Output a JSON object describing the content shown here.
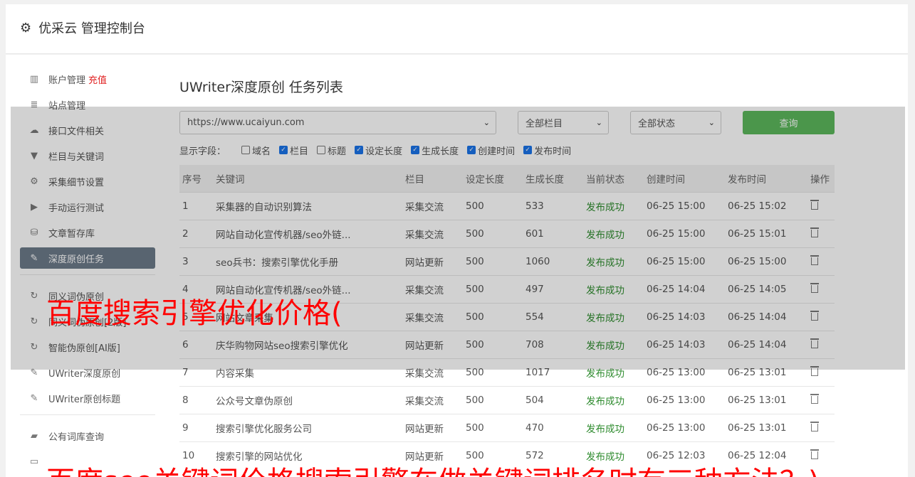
{
  "header": {
    "icon": "gear-icon",
    "title": "优采云 管理控制台"
  },
  "sidebar": {
    "group1": [
      {
        "icon": "bar-chart-icon",
        "glyph": "▥",
        "label": "账户管理",
        "badge": "充值"
      },
      {
        "icon": "server-icon",
        "glyph": "≣",
        "label": "站点管理"
      },
      {
        "icon": "cloud-upload-icon",
        "glyph": "☁",
        "label": "接口文件相关"
      },
      {
        "icon": "filter-icon",
        "glyph": "▼",
        "label": "栏目与关键词"
      },
      {
        "icon": "gears-icon",
        "glyph": "⚙",
        "label": "采集细节设置"
      },
      {
        "icon": "play-icon",
        "glyph": "▶",
        "label": "手动运行测试"
      },
      {
        "icon": "database-icon",
        "glyph": "⛁",
        "label": "文章暂存库"
      },
      {
        "icon": "edit-icon",
        "glyph": "✎",
        "label": "深度原创任务",
        "active": true
      }
    ],
    "group2": [
      {
        "icon": "refresh-icon",
        "glyph": "↻",
        "label": "同义词伪原创"
      },
      {
        "icon": "refresh-icon",
        "glyph": "↻",
        "label": "同义词伪原创[2版]"
      },
      {
        "icon": "refresh-icon",
        "glyph": "↻",
        "label": "智能伪原创[AI版]"
      },
      {
        "icon": "edit-icon",
        "glyph": "✎",
        "label": "UWriter深度原创"
      },
      {
        "icon": "edit-icon",
        "glyph": "✎",
        "label": "UWriter原创标题"
      }
    ],
    "group3": [
      {
        "icon": "book-icon",
        "glyph": "▰",
        "label": "公有词库查询"
      },
      {
        "icon": "monitor-icon",
        "glyph": "▭",
        "label": ""
      }
    ]
  },
  "main": {
    "title": "UWriter深度原创 任务列表",
    "site_select": "https://www.ucaiyun.com",
    "column_select": "全部栏目",
    "status_select": "全部状态",
    "query_button": "查询",
    "fields_label": "显示字段：",
    "fields": [
      {
        "label": "域名",
        "checked": false
      },
      {
        "label": "栏目",
        "checked": true
      },
      {
        "label": "标题",
        "checked": false
      },
      {
        "label": "设定长度",
        "checked": true
      },
      {
        "label": "生成长度",
        "checked": true
      },
      {
        "label": "创建时间",
        "checked": true
      },
      {
        "label": "发布时间",
        "checked": true
      }
    ],
    "columns": [
      "序号",
      "关键词",
      "栏目",
      "设定长度",
      "生成长度",
      "当前状态",
      "创建时间",
      "发布时间",
      "操作"
    ],
    "rows": [
      [
        "1",
        "采集器的自动识别算法",
        "采集交流",
        "500",
        "533",
        "发布成功",
        "06-25 15:00",
        "06-25 15:02"
      ],
      [
        "2",
        "网站自动化宣传机器/seo外链...",
        "采集交流",
        "500",
        "601",
        "发布成功",
        "06-25 15:00",
        "06-25 15:01"
      ],
      [
        "3",
        "seo兵书：搜索引擎优化手册",
        "网站更新",
        "500",
        "1060",
        "发布成功",
        "06-25 15:00",
        "06-25 15:00"
      ],
      [
        "4",
        "网站自动化宣传机器/seo外链...",
        "采集交流",
        "500",
        "497",
        "发布成功",
        "06-25 14:04",
        "06-25 14:05"
      ],
      [
        "5",
        "网站文章采集",
        "采集交流",
        "500",
        "554",
        "发布成功",
        "06-25 14:03",
        "06-25 14:04"
      ],
      [
        "6",
        "庆华购物网站seo搜索引擎优化",
        "网站更新",
        "500",
        "708",
        "发布成功",
        "06-25 14:03",
        "06-25 14:04"
      ],
      [
        "7",
        "内容采集",
        "采集交流",
        "500",
        "1017",
        "发布成功",
        "06-25 13:00",
        "06-25 13:01"
      ],
      [
        "8",
        "公众号文章伪原创",
        "采集交流",
        "500",
        "504",
        "发布成功",
        "06-25 13:00",
        "06-25 13:01"
      ],
      [
        "9",
        "搜索引擎优化服务公司",
        "网站更新",
        "500",
        "470",
        "发布成功",
        "06-25 13:00",
        "06-25 13:01"
      ],
      [
        "10",
        "搜索引擎的网站优化",
        "网站更新",
        "500",
        "572",
        "发布成功",
        "06-25 12:03",
        "06-25 12:04"
      ]
    ]
  },
  "overlay": {
    "headline": "百度搜索引擎优化价格(",
    "bottom_headline": "百度seo关键词价格搜索引擎在做关键词排名时有三种方法？)"
  },
  "colors": {
    "accent_green": "#5cb85c",
    "active_nav": "#6c7a89",
    "status_ok": "#2e8b2e",
    "overlay_red": "#ff0000"
  }
}
